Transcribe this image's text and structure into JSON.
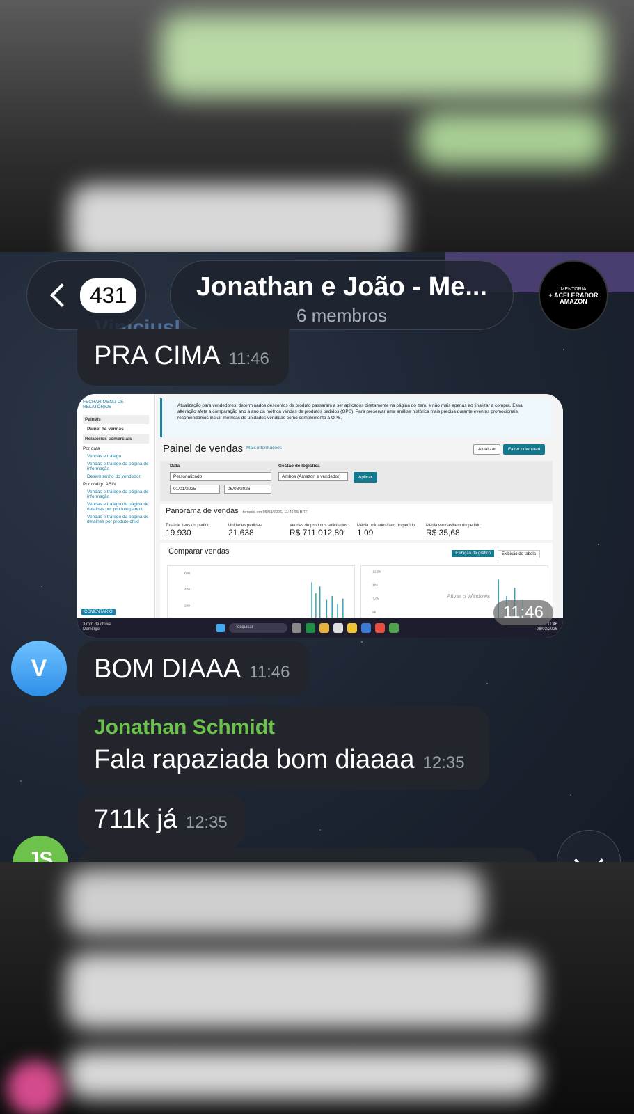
{
  "header": {
    "unread_count": "431",
    "chat_title": "Jonathan e João - Me...",
    "members": "6 membros",
    "avatar_lines": [
      "MENTORIA",
      "+ ACELERADOR",
      "AMAZON"
    ]
  },
  "messages": {
    "m1": {
      "sender": "ViniciusI",
      "text": "PRA CIMA",
      "time": "11:46"
    },
    "m2": {
      "type": "image",
      "time": "11:46"
    },
    "m3": {
      "avatar_letter": "V",
      "text": "BOM DIAAA",
      "time": "11:46"
    },
    "m4": {
      "sender": "Jonathan Schmidt",
      "text": "Fala rapaziada bom diaaaa",
      "time": "12:35"
    },
    "m5": {
      "text": "711k já",
      "time": "12:35"
    },
    "m6": {
      "avatar_letters": "JS"
    }
  },
  "screenshot": {
    "sidebar": {
      "close_menu": "FECHAR MENU DE RELATÓRIOS",
      "section_panels": "Painéis",
      "panel_sales": "Painel de vendas",
      "section_reports": "Relatórios comerciais",
      "by_date": "Por data",
      "link1": "Vendas e tráfego",
      "link2": "Vendas e tráfego da página de informação",
      "link3": "Desempenho do vendedor",
      "by_asin": "Por código ASIN",
      "link4": "Vendas e tráfego da página de informação",
      "link5": "Vendas e tráfego da página de detalhes por produto parent",
      "link6": "Vendas e tráfego da página de detalhes por produto child",
      "comment": "COMENTÁRIO"
    },
    "alert": "Atualização para vendedores: determinados descontos de produto passaram a ser aplicados diretamente na página do item, e não mais apenas ao finalizar a compra. Essa alteração afeta a comparação ano a ano da métrica vendas de produtos pedidos (OPS). Para preservar uma análise histórica mais precisa durante eventos promocionais, recomendamos incluir métricas de unidades vendidas como complemento à OPS.",
    "title": "Painel de vendas",
    "more_info": "Mais informações",
    "btn_update": "Atualizar",
    "btn_download": "Fazer download",
    "label_date": "Data",
    "select_date": "Personalizado",
    "label_logistics": "Gestão de logística",
    "select_logistics": "Ambos (Amazon e vendedor)",
    "btn_apply": "Aplicar",
    "date_from": "01/01/2025",
    "date_to": "06/03/2026",
    "summary_title": "Panorama de vendas",
    "summary_taken": "tomado em 06/03/2026, 11:45:55 BRT",
    "metrics": [
      {
        "label": "Total de itens do pedido",
        "value": "19.930"
      },
      {
        "label": "Unidades pedidas",
        "value": "21.638"
      },
      {
        "label": "Vendas de produtos solicitados",
        "value": "R$ 711.012,80"
      },
      {
        "label": "Média unidades/item do pedido",
        "value": "1,09"
      },
      {
        "label": "Média vendas/item do pedido",
        "value": "R$ 35,68"
      }
    ],
    "compare_title": "Comparar vendas",
    "tab_chart": "Exibição de gráfico",
    "tab_table": "Exibição de tabela",
    "chart_left_ticks": [
      "600",
      "400",
      "200"
    ],
    "chart_right_ticks": [
      "12,5k",
      "10k",
      "7,5k",
      "5k"
    ],
    "watermark": "Ativar o Windows",
    "taskbar_weather": "3 mm de chuva",
    "taskbar_weather_day": "Domingo",
    "taskbar_search": "Pesquisar",
    "taskbar_time": "11:46",
    "taskbar_date": "06/03/2026"
  }
}
